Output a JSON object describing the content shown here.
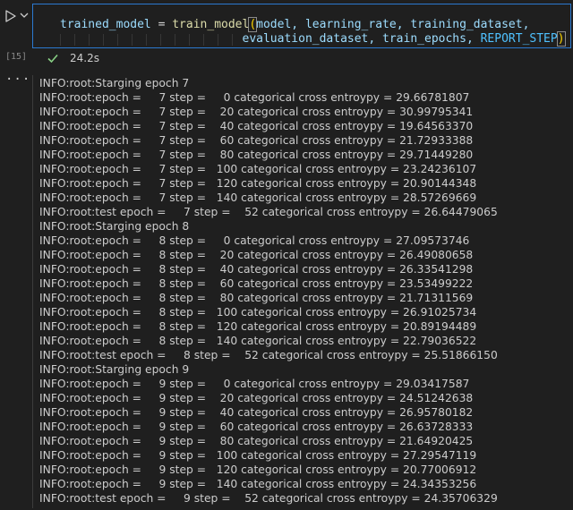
{
  "cell": {
    "execution_count": "[15]",
    "code_line1": {
      "var": "trained_model",
      "op": " = ",
      "fn": "train_model",
      "open": "(",
      "args1": "model, learning_rate, training_dataset,"
    },
    "code_line2": {
      "indent": "                          ",
      "args2": "evaluation_dataset, train_epochs, ",
      "const": "REPORT_STEP",
      "close": ")"
    },
    "status": "24.2s"
  },
  "output": {
    "lines": [
      "INFO:root:Starging epoch 7",
      "INFO:root:epoch =     7 step =     0 categorical cross entroypy = 29.66781807",
      "INFO:root:epoch =     7 step =    20 categorical cross entroypy = 30.99795341",
      "INFO:root:epoch =     7 step =    40 categorical cross entroypy = 19.64563370",
      "INFO:root:epoch =     7 step =    60 categorical cross entroypy = 21.72933388",
      "INFO:root:epoch =     7 step =    80 categorical cross entroypy = 29.71449280",
      "INFO:root:epoch =     7 step =   100 categorical cross entroypy = 23.24236107",
      "INFO:root:epoch =     7 step =   120 categorical cross entroypy = 20.90144348",
      "INFO:root:epoch =     7 step =   140 categorical cross entroypy = 28.57269669",
      "INFO:root:test epoch =     7 step =    52 categorical cross entroypy = 26.64479065",
      "INFO:root:Starging epoch 8",
      "INFO:root:epoch =     8 step =     0 categorical cross entroypy = 27.09573746",
      "INFO:root:epoch =     8 step =    20 categorical cross entroypy = 26.49080658",
      "INFO:root:epoch =     8 step =    40 categorical cross entroypy = 26.33541298",
      "INFO:root:epoch =     8 step =    60 categorical cross entroypy = 23.53499222",
      "INFO:root:epoch =     8 step =    80 categorical cross entroypy = 21.71311569",
      "INFO:root:epoch =     8 step =   100 categorical cross entroypy = 26.91025734",
      "INFO:root:epoch =     8 step =   120 categorical cross entroypy = 20.89194489",
      "INFO:root:epoch =     8 step =   140 categorical cross entroypy = 22.79036522",
      "INFO:root:test epoch =     8 step =    52 categorical cross entroypy = 25.51866150",
      "INFO:root:Starging epoch 9",
      "INFO:root:epoch =     9 step =     0 categorical cross entroypy = 29.03417587",
      "INFO:root:epoch =     9 step =    20 categorical cross entroypy = 24.51242638",
      "INFO:root:epoch =     9 step =    40 categorical cross entroypy = 26.95780182",
      "INFO:root:epoch =     9 step =    60 categorical cross entroypy = 26.63728333",
      "INFO:root:epoch =     9 step =    80 categorical cross entroypy = 21.64920425",
      "INFO:root:epoch =     9 step =   100 categorical cross entroypy = 27.29547119",
      "INFO:root:epoch =     9 step =   120 categorical cross entroypy = 20.77006912",
      "INFO:root:epoch =     9 step =   140 categorical cross entroypy = 24.34353256",
      "INFO:root:test epoch =     9 step =    52 categorical cross entroypy = 24.35706329"
    ]
  },
  "icons": {
    "run": "play-icon",
    "run_menu": "chevron-down-icon",
    "success": "check-icon",
    "output_menu": "ellipsis-icon"
  },
  "colors": {
    "background": "#1f1f1f",
    "focus_border": "#2b79d0",
    "variable": "#9cdcfe",
    "function": "#dcdcaa",
    "constant": "#4fc1ff",
    "paren": "#ffd700",
    "success": "#89d185"
  }
}
